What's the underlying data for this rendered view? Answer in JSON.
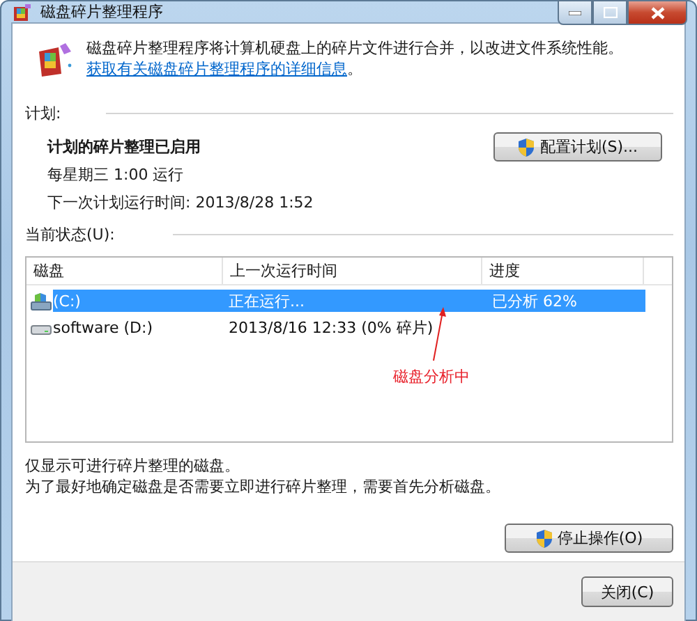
{
  "window": {
    "title": "磁盘碎片整理程序"
  },
  "intro": {
    "text": "磁盘碎片整理程序将计算机硬盘上的碎片文件进行合并，以改进文件系统性能。",
    "link": "获取有关磁盘碎片整理程序的详细信息",
    "end": "。"
  },
  "schedule": {
    "heading": "计划:",
    "status": "计划的碎片整理已启用",
    "run": "每星期三  1:00 运行",
    "next": "下一次计划运行时间: 2013/8/28 1:52",
    "button": "配置计划(S)..."
  },
  "current": {
    "heading": "当前状态(U):",
    "columns": [
      "磁盘",
      "上一次运行时间",
      "进度"
    ],
    "rows": [
      {
        "kind": "system",
        "disk": "(C:)",
        "last_run": "正在运行...",
        "progress": "已分析 62%",
        "selected": true
      },
      {
        "kind": "drive",
        "disk": "software (D:)",
        "last_run": "2013/8/16 12:33 (0% 碎片)",
        "progress": "",
        "selected": false
      }
    ]
  },
  "annotation": {
    "text": "磁盘分析中"
  },
  "notes": [
    "仅显示可进行碎片整理的磁盘。",
    "为了最好地确定磁盘是否需要立即进行碎片整理，需要首先分析磁盘。"
  ],
  "buttons": {
    "stop": "停止操作(O)",
    "close": "关闭(C)"
  }
}
